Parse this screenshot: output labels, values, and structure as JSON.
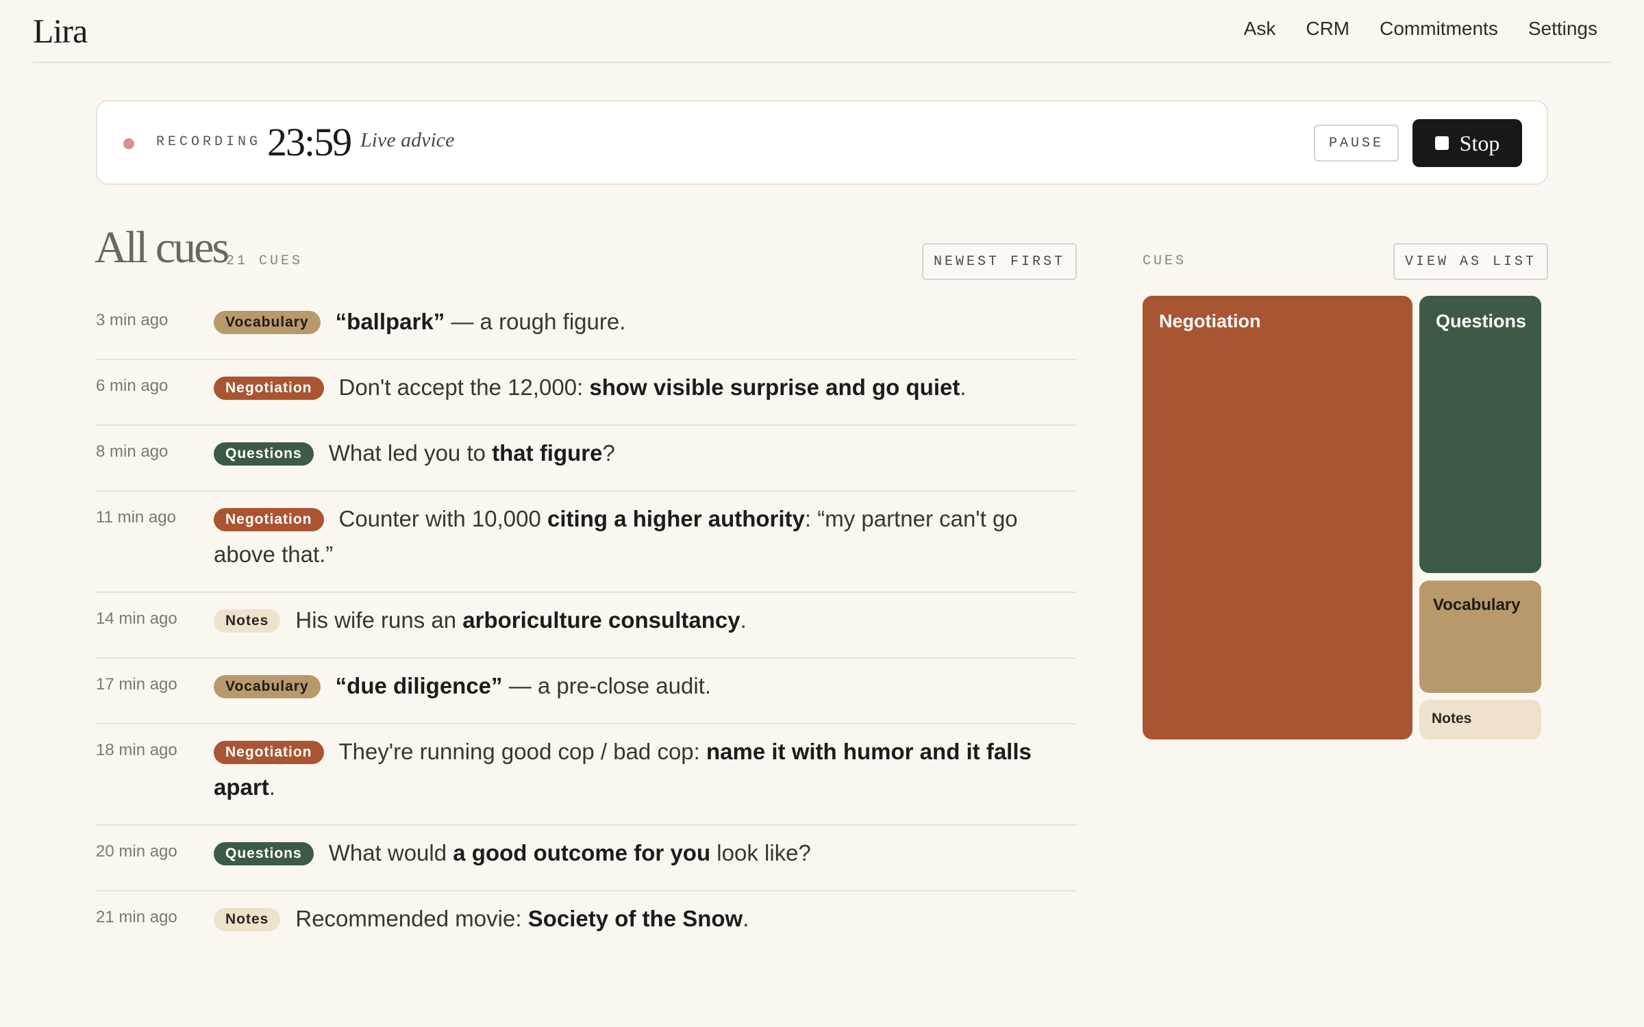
{
  "nav": {
    "logo": "Lira",
    "links": [
      "Ask",
      "CRM",
      "Commitments",
      "Settings"
    ]
  },
  "recording": {
    "label": "RECORDING",
    "timer": "23:59",
    "mode": "Live advice",
    "pause_label": "PAUSE",
    "stop_label": "Stop"
  },
  "list": {
    "title": "All cues",
    "count": "21 CUES",
    "sort_label": "NEWEST FIRST"
  },
  "panel": {
    "label": "CUES",
    "view_label": "VIEW AS LIST"
  },
  "cues": [
    {
      "time": "3 min ago",
      "tag": "Vocabulary",
      "parts": [
        {
          "t": "“ballpark”",
          "b": true
        },
        {
          "t": " — a rough figure."
        }
      ]
    },
    {
      "time": "6 min ago",
      "tag": "Negotiation",
      "parts": [
        {
          "t": "Don't accept the 12,000: "
        },
        {
          "t": "show visible surprise and go quiet",
          "b": true
        },
        {
          "t": "."
        }
      ]
    },
    {
      "time": "8 min ago",
      "tag": "Questions",
      "parts": [
        {
          "t": "What led you to "
        },
        {
          "t": "that figure",
          "b": true
        },
        {
          "t": "?"
        }
      ]
    },
    {
      "time": "11 min ago",
      "tag": "Negotiation",
      "parts": [
        {
          "t": "Counter with 10,000 "
        },
        {
          "t": "citing a higher authority",
          "b": true
        },
        {
          "t": ": “my partner can't go above that.”"
        }
      ]
    },
    {
      "time": "14 min ago",
      "tag": "Notes",
      "parts": [
        {
          "t": "His wife runs an "
        },
        {
          "t": "arboriculture consultancy",
          "b": true
        },
        {
          "t": "."
        }
      ]
    },
    {
      "time": "17 min ago",
      "tag": "Vocabulary",
      "parts": [
        {
          "t": "“due diligence”",
          "b": true
        },
        {
          "t": " — a pre-close audit."
        }
      ]
    },
    {
      "time": "18 min ago",
      "tag": "Negotiation",
      "parts": [
        {
          "t": "They're running good cop / bad cop: "
        },
        {
          "t": "name it with humor and it falls apart",
          "b": true
        },
        {
          "t": "."
        }
      ]
    },
    {
      "time": "20 min ago",
      "tag": "Questions",
      "parts": [
        {
          "t": "What would "
        },
        {
          "t": "a good outcome for you",
          "b": true
        },
        {
          "t": " look like?"
        }
      ]
    },
    {
      "time": "21 min ago",
      "tag": "Notes",
      "parts": [
        {
          "t": "Recommended movie: "
        },
        {
          "t": "Society of the Snow",
          "b": true
        },
        {
          "t": "."
        }
      ]
    }
  ],
  "categories": [
    {
      "name": "Negotiation",
      "color": "#a95532"
    },
    {
      "name": "Questions",
      "color": "#3d5a47"
    },
    {
      "name": "Vocabulary",
      "color": "#b8996b"
    },
    {
      "name": "Notes",
      "color": "#eee2cc"
    }
  ]
}
